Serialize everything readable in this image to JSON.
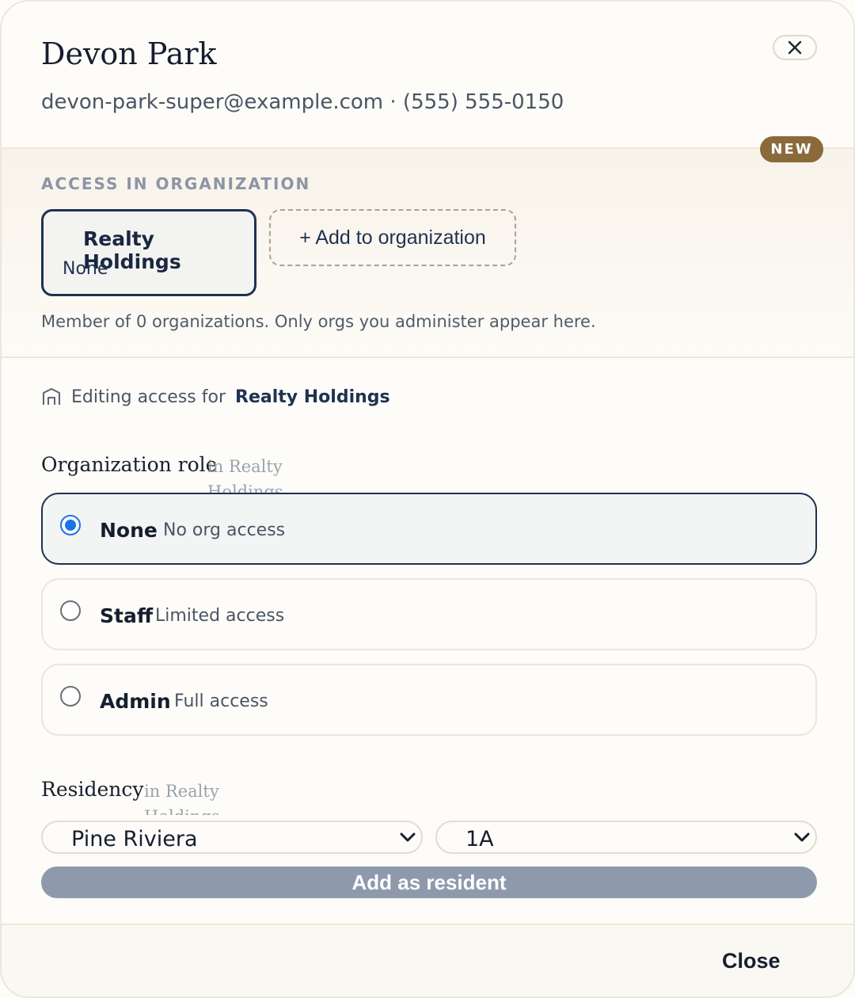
{
  "header": {
    "name": "Devon Park",
    "contact": "devon-park-super@example.com · (555) 555-0150",
    "close_icon": "close-icon"
  },
  "badge": {
    "label": "NEW",
    "color": "#8a6a3b"
  },
  "org_section": {
    "label": "ACCESS IN ORGANIZATION",
    "org_card": {
      "name": "Realty Holdings",
      "role": "None"
    },
    "add_button": "+ Add to organization",
    "note": "Member of 0 organizations. Only orgs you administer appear here."
  },
  "editing": {
    "prefix": "Editing access for",
    "org": "Realty Holdings",
    "icon": "building-icon"
  },
  "org_role": {
    "title": "Organization role",
    "sub": "in Realty Holdings",
    "options": [
      {
        "name": "None",
        "desc": "No org access",
        "selected": true
      },
      {
        "name": "Staff",
        "desc": "Limited access",
        "selected": false
      },
      {
        "name": "Admin",
        "desc": "Full access",
        "selected": false
      }
    ]
  },
  "residency": {
    "title": "Residency",
    "sub": "in Realty Holdings",
    "property_value": "Pine Riviera",
    "unit_value": "1A",
    "add_button": "Add as resident"
  },
  "footer": {
    "close_label": "Close"
  },
  "colors": {
    "accent": "#1f3251",
    "radio": "#1a73e8",
    "disabled_button": "#8e9aac"
  }
}
